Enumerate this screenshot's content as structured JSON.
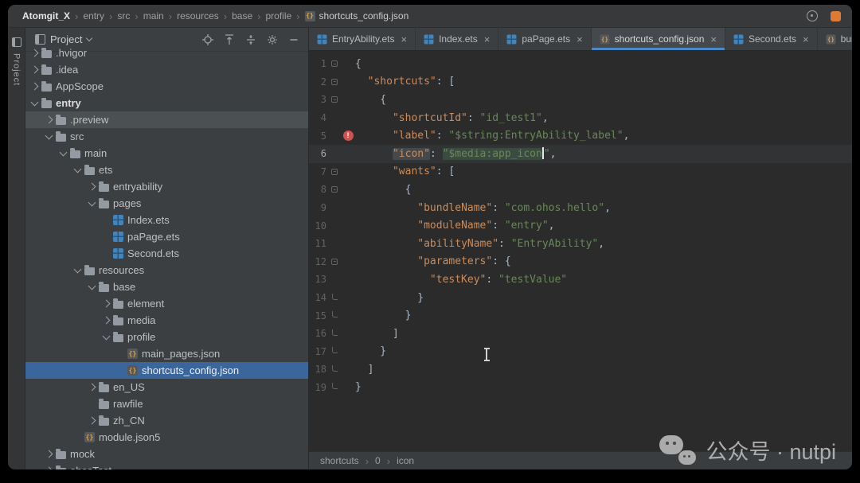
{
  "colors": {
    "accent_blue": "#4a88c7",
    "selection_blue": "#3b669c",
    "key_orange": "#cc8c5c",
    "string_green": "#6a8759",
    "punct_grey": "#a9b7c6",
    "error_red": "#d35050",
    "notification_orange": "#dd7a33"
  },
  "titlebar": {
    "path": [
      "Atomgit_X",
      "entry",
      "src",
      "main",
      "resources",
      "base",
      "profile"
    ],
    "file": "shortcuts_config.json",
    "right_icons": [
      "sync-icon",
      "notification-badge"
    ]
  },
  "tool_stripe": {
    "label": "Project"
  },
  "project_panel": {
    "title": "Project",
    "header_icons": [
      "locate-icon",
      "expand-all-icon",
      "collapse-all-icon",
      "gear-icon",
      "hide-icon"
    ],
    "tree": [
      {
        "label": ".hvigor",
        "depth": 1,
        "chevron": "right",
        "icon": "folder"
      },
      {
        "label": ".idea",
        "depth": 1,
        "chevron": "right",
        "icon": "folder"
      },
      {
        "label": "AppScope",
        "depth": 1,
        "chevron": "right",
        "icon": "folder"
      },
      {
        "label": "entry",
        "depth": 1,
        "chevron": "down",
        "icon": "folder",
        "bold": true
      },
      {
        "label": ".preview",
        "depth": 2,
        "chevron": "right",
        "icon": "folder",
        "state": "hover"
      },
      {
        "label": "src",
        "depth": 2,
        "chevron": "down",
        "icon": "folder"
      },
      {
        "label": "main",
        "depth": 3,
        "chevron": "down",
        "icon": "folder"
      },
      {
        "label": "ets",
        "depth": 4,
        "chevron": "down",
        "icon": "folder"
      },
      {
        "label": "entryability",
        "depth": 5,
        "chevron": "right",
        "icon": "folder"
      },
      {
        "label": "pages",
        "depth": 5,
        "chevron": "down",
        "icon": "folder"
      },
      {
        "label": "Index.ets",
        "depth": 6,
        "icon": "ets"
      },
      {
        "label": "paPage.ets",
        "depth": 6,
        "icon": "ets"
      },
      {
        "label": "Second.ets",
        "depth": 6,
        "icon": "ets"
      },
      {
        "label": "resources",
        "depth": 4,
        "chevron": "down",
        "icon": "folder"
      },
      {
        "label": "base",
        "depth": 5,
        "chevron": "down",
        "icon": "folder"
      },
      {
        "label": "element",
        "depth": 6,
        "chevron": "right",
        "icon": "folder"
      },
      {
        "label": "media",
        "depth": 6,
        "chevron": "right",
        "icon": "folder"
      },
      {
        "label": "profile",
        "depth": 6,
        "chevron": "down",
        "icon": "folder"
      },
      {
        "label": "main_pages.json",
        "depth": 7,
        "icon": "json"
      },
      {
        "label": "shortcuts_config.json",
        "depth": 7,
        "icon": "json",
        "state": "selected"
      },
      {
        "label": "en_US",
        "depth": 5,
        "chevron": "right",
        "icon": "folder"
      },
      {
        "label": "rawfile",
        "depth": 5,
        "icon": "folder"
      },
      {
        "label": "zh_CN",
        "depth": 5,
        "chevron": "right",
        "icon": "folder"
      },
      {
        "label": "module.json5",
        "depth": 4,
        "icon": "json"
      },
      {
        "label": "mock",
        "depth": 2,
        "chevron": "right",
        "icon": "folder"
      },
      {
        "label": "ohosTest",
        "depth": 2,
        "chevron": "right",
        "icon": "folder"
      }
    ]
  },
  "tabs": [
    {
      "label": "EntryAbility.ets",
      "icon": "ets"
    },
    {
      "label": "Index.ets",
      "icon": "ets"
    },
    {
      "label": "paPage.ets",
      "icon": "ets"
    },
    {
      "label": "shortcuts_config.json",
      "icon": "json",
      "active": true
    },
    {
      "label": "Second.ets",
      "icon": "ets"
    },
    {
      "label": "build-",
      "icon": "json",
      "truncated": true
    }
  ],
  "editor": {
    "breadcrumb": [
      "shortcuts",
      "0",
      "icon"
    ],
    "lines": [
      {
        "n": 1,
        "fold": "box",
        "tokens": [
          {
            "t": "{",
            "c": "p"
          }
        ]
      },
      {
        "n": 2,
        "fold": "box",
        "tokens": [
          {
            "t": "  ",
            "c": "p"
          },
          {
            "t": "\"shortcuts\"",
            "c": "k"
          },
          {
            "t": ": [",
            "c": "p"
          }
        ]
      },
      {
        "n": 3,
        "fold": "box",
        "tokens": [
          {
            "t": "    {",
            "c": "p"
          }
        ]
      },
      {
        "n": 4,
        "tokens": [
          {
            "t": "      ",
            "c": "p"
          },
          {
            "t": "\"shortcutId\"",
            "c": "k"
          },
          {
            "t": ": ",
            "c": "p"
          },
          {
            "t": "\"id_test1\"",
            "c": "v"
          },
          {
            "t": ",",
            "c": "p"
          }
        ]
      },
      {
        "n": 5,
        "gutter": "error",
        "tokens": [
          {
            "t": "      ",
            "c": "p"
          },
          {
            "t": "\"label\"",
            "c": "k"
          },
          {
            "t": ": ",
            "c": "p"
          },
          {
            "t": "\"$string:EntryAbility_label\"",
            "c": "v"
          },
          {
            "t": ",",
            "c": "p"
          }
        ]
      },
      {
        "n": 6,
        "caret": true,
        "tokens": [
          {
            "t": "      ",
            "c": "p"
          },
          {
            "t": "\"icon\"",
            "c": "k",
            "hl": true
          },
          {
            "t": ": ",
            "c": "p"
          },
          {
            "t": "\"$media:app_icon",
            "c": "v",
            "sel": true
          },
          {
            "t": "",
            "c": "caret"
          },
          {
            "t": "\"",
            "c": "v"
          },
          {
            "t": ",",
            "c": "p"
          }
        ]
      },
      {
        "n": 7,
        "fold": "box",
        "tokens": [
          {
            "t": "      ",
            "c": "p"
          },
          {
            "t": "\"wants\"",
            "c": "k"
          },
          {
            "t": ": [",
            "c": "p"
          }
        ]
      },
      {
        "n": 8,
        "fold": "box",
        "tokens": [
          {
            "t": "        {",
            "c": "p"
          }
        ]
      },
      {
        "n": 9,
        "tokens": [
          {
            "t": "          ",
            "c": "p"
          },
          {
            "t": "\"bundleName\"",
            "c": "k"
          },
          {
            "t": ": ",
            "c": "p"
          },
          {
            "t": "\"com.ohos.hello\"",
            "c": "v"
          },
          {
            "t": ",",
            "c": "p"
          }
        ]
      },
      {
        "n": 10,
        "tokens": [
          {
            "t": "          ",
            "c": "p"
          },
          {
            "t": "\"moduleName\"",
            "c": "k"
          },
          {
            "t": ": ",
            "c": "p"
          },
          {
            "t": "\"entry\"",
            "c": "v"
          },
          {
            "t": ",",
            "c": "p"
          }
        ]
      },
      {
        "n": 11,
        "tokens": [
          {
            "t": "          ",
            "c": "p"
          },
          {
            "t": "\"abilityName\"",
            "c": "k"
          },
          {
            "t": ": ",
            "c": "p"
          },
          {
            "t": "\"EntryAbility\"",
            "c": "v"
          },
          {
            "t": ",",
            "c": "p"
          }
        ]
      },
      {
        "n": 12,
        "fold": "box",
        "tokens": [
          {
            "t": "          ",
            "c": "p"
          },
          {
            "t": "\"parameters\"",
            "c": "k"
          },
          {
            "t": ": {",
            "c": "p"
          }
        ]
      },
      {
        "n": 13,
        "tokens": [
          {
            "t": "            ",
            "c": "p"
          },
          {
            "t": "\"testKey\"",
            "c": "k"
          },
          {
            "t": ": ",
            "c": "p"
          },
          {
            "t": "\"testValue\"",
            "c": "v"
          }
        ]
      },
      {
        "n": 14,
        "fold": "end",
        "tokens": [
          {
            "t": "          }",
            "c": "p"
          }
        ]
      },
      {
        "n": 15,
        "fold": "end",
        "tokens": [
          {
            "t": "        }",
            "c": "p"
          }
        ]
      },
      {
        "n": 16,
        "fold": "end",
        "tokens": [
          {
            "t": "      ]",
            "c": "p"
          }
        ]
      },
      {
        "n": 17,
        "fold": "end",
        "tokens": [
          {
            "t": "    }",
            "c": "p"
          }
        ]
      },
      {
        "n": 18,
        "fold": "end",
        "tokens": [
          {
            "t": "  ]",
            "c": "p"
          }
        ]
      },
      {
        "n": 19,
        "fold": "end",
        "tokens": [
          {
            "t": "}",
            "c": "p"
          }
        ]
      }
    ]
  },
  "watermark": {
    "text": "公众号 · nutpi"
  }
}
